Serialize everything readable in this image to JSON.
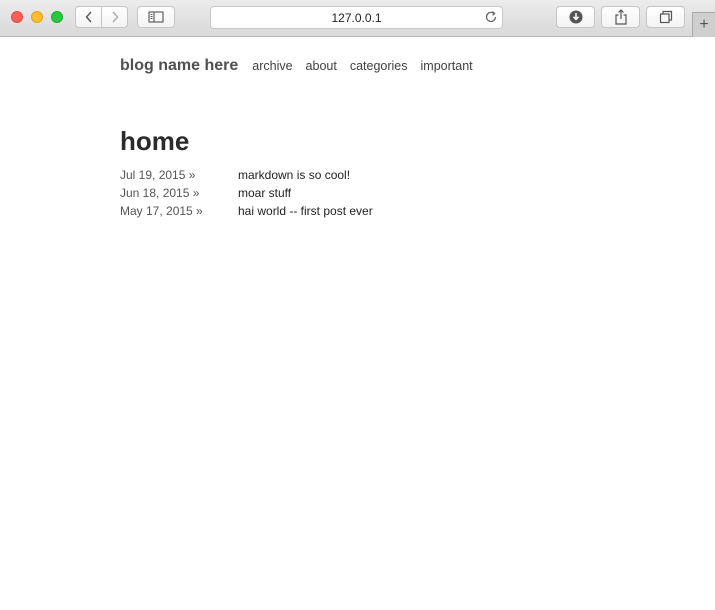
{
  "browser": {
    "url": "127.0.0.1",
    "new_tab_symbol": "+",
    "icons": {
      "back": "chevron-left-icon",
      "forward": "chevron-right-icon",
      "sidebar": "sidebar-icon",
      "reload": "reload-icon",
      "downloads": "download-icon",
      "share": "share-icon",
      "tabs": "tabs-overview-icon"
    }
  },
  "site": {
    "title": "blog name here",
    "nav": [
      "archive",
      "about",
      "categories",
      "important"
    ]
  },
  "page": {
    "title": "home",
    "posts": [
      {
        "date": "Jul 19, 2015 »",
        "title": "markdown is so cool!"
      },
      {
        "date": "Jun 18, 2015 »",
        "title": "moar stuff"
      },
      {
        "date": "May 17, 2015 »",
        "title": "hai world -- first post ever"
      }
    ]
  }
}
